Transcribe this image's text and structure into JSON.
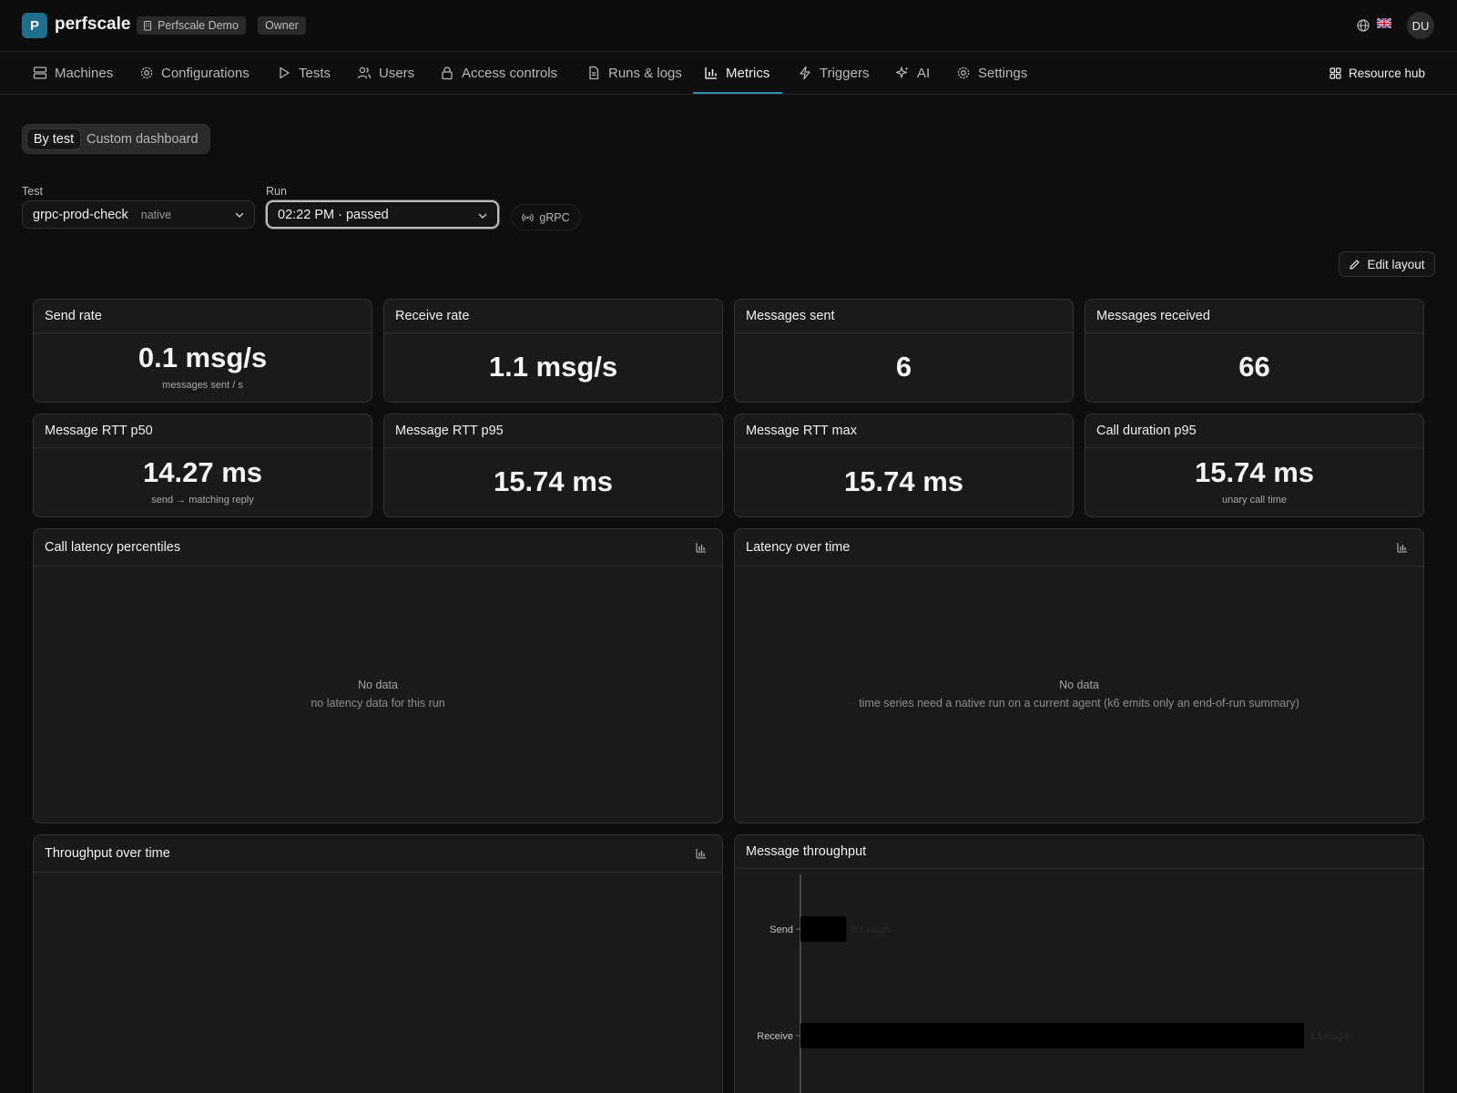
{
  "app": {
    "logo_letter": "P",
    "brand": "perfscale",
    "org": "Perfscale Demo",
    "role": "Owner",
    "avatar_initials": "DU"
  },
  "nav": {
    "items": [
      {
        "label": "Machines",
        "icon": "machines-icon"
      },
      {
        "label": "Configurations",
        "icon": "gear-icon"
      },
      {
        "label": "Tests",
        "icon": "play-icon"
      },
      {
        "label": "Users",
        "icon": "users-icon"
      },
      {
        "label": "Access controls",
        "icon": "lock-icon"
      },
      {
        "label": "Runs & logs",
        "icon": "document-icon"
      },
      {
        "label": "Metrics",
        "icon": "bar-chart-icon"
      },
      {
        "label": "Triggers",
        "icon": "lightning-icon"
      },
      {
        "label": "AI",
        "icon": "sparkles-icon"
      },
      {
        "label": "Settings",
        "icon": "gear-icon"
      }
    ],
    "active": "Metrics",
    "resource_hub": "Resource hub"
  },
  "view_toggle": {
    "by_test": "By test",
    "custom": "Custom dashboard"
  },
  "filters": {
    "test_label": "Test",
    "test_value": "grpc-prod-check",
    "test_tag": "native",
    "run_label": "Run",
    "run_value": "02:22 PM · passed",
    "protocol": "gRPC"
  },
  "edit_layout": "Edit layout",
  "stats": [
    {
      "title": "Send rate",
      "value": "0.1 msg/s",
      "sub": "messages sent / s"
    },
    {
      "title": "Receive rate",
      "value": "1.1 msg/s",
      "sub": ""
    },
    {
      "title": "Messages sent",
      "value": "6",
      "sub": ""
    },
    {
      "title": "Messages received",
      "value": "66",
      "sub": ""
    },
    {
      "title": "Message RTT p50",
      "value": "14.27 ms",
      "sub": "send → matching reply"
    },
    {
      "title": "Message RTT p95",
      "value": "15.74 ms",
      "sub": ""
    },
    {
      "title": "Message RTT max",
      "value": "15.74 ms",
      "sub": ""
    },
    {
      "title": "Call duration p95",
      "value": "15.74 ms",
      "sub": "unary call time"
    }
  ],
  "panels": {
    "call_latency": {
      "title": "Call latency percentiles",
      "empty_title": "No data",
      "empty_sub": "no latency data for this run"
    },
    "latency_time": {
      "title": "Latency over time",
      "empty_title": "No data",
      "empty_sub": "time series need a native run on a current agent (k6 emits only an end-of-run summary)"
    },
    "throughput_time": {
      "title": "Throughput over time"
    },
    "message_throughput": {
      "title": "Message throughput"
    }
  },
  "chart_data": {
    "type": "bar",
    "orientation": "horizontal",
    "title": "Message throughput",
    "categories": [
      "Send",
      "Receive"
    ],
    "values": [
      0.1,
      1.1
    ],
    "value_labels": [
      "0.1 msg/s",
      "1.1 msg/s"
    ],
    "unit": "msg/s",
    "bar_color": "#000000"
  },
  "colors": {
    "accent": "#2e8fb3",
    "logo": "#1f6e8c",
    "background": "#0e0e0e",
    "card": "#1a1a1a"
  }
}
